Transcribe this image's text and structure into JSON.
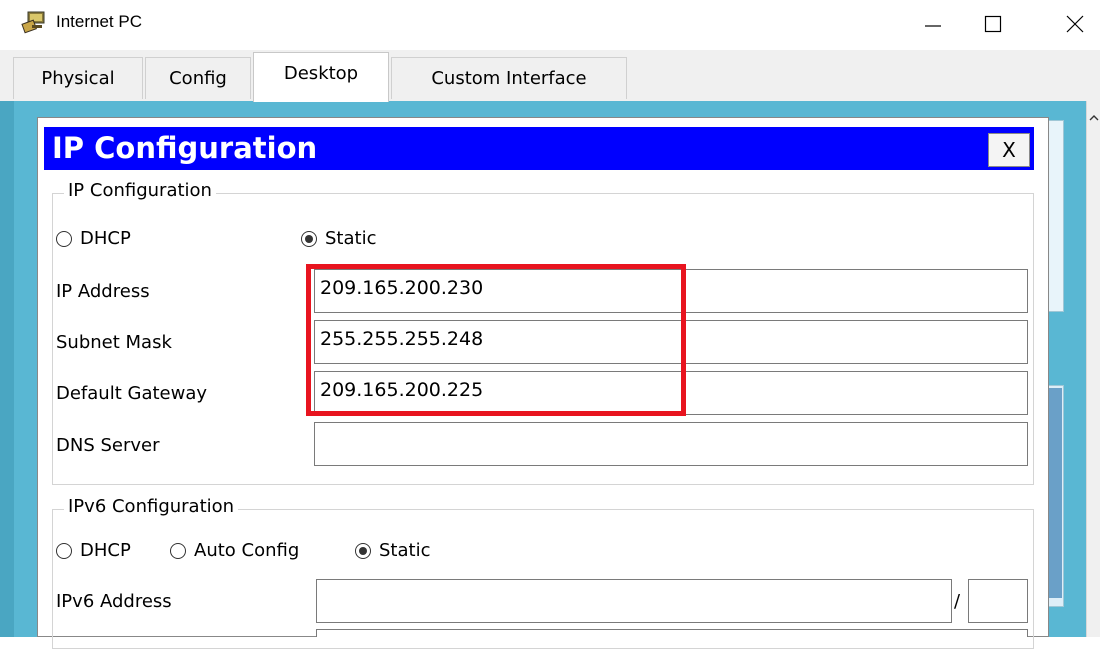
{
  "window": {
    "title": "Internet PC",
    "icon": "packet-tracer-pc-icon",
    "controls": [
      "minimize-icon",
      "maximize-icon",
      "close-icon"
    ]
  },
  "tabs": [
    {
      "label": "Physical",
      "active": false
    },
    {
      "label": "Config",
      "active": false
    },
    {
      "label": "Desktop",
      "active": true
    },
    {
      "label": "Custom Interface",
      "active": false
    }
  ],
  "dialog": {
    "title": "IP Configuration",
    "close_label": "X",
    "ipv4": {
      "legend": "IP Configuration",
      "mode_options": [
        {
          "label": "DHCP",
          "selected": false
        },
        {
          "label": "Static",
          "selected": true
        }
      ],
      "fields": [
        {
          "label": "IP Address",
          "value": "209.165.200.230"
        },
        {
          "label": "Subnet Mask",
          "value": "255.255.255.248"
        },
        {
          "label": "Default Gateway",
          "value": "209.165.200.225"
        },
        {
          "label": "DNS Server",
          "value": ""
        }
      ]
    },
    "ipv6": {
      "legend": "IPv6 Configuration",
      "mode_options": [
        {
          "label": "DHCP",
          "selected": false
        },
        {
          "label": "Auto Config",
          "selected": false
        },
        {
          "label": "Static",
          "selected": true
        }
      ],
      "address_label": "IPv6 Address",
      "address_value": "",
      "prefix_separator": "/",
      "prefix_value": ""
    }
  },
  "colors": {
    "dialog_title_bg": "#0000ff",
    "desktop_bg": "#59b7d3",
    "highlight_border": "#e8141f"
  }
}
